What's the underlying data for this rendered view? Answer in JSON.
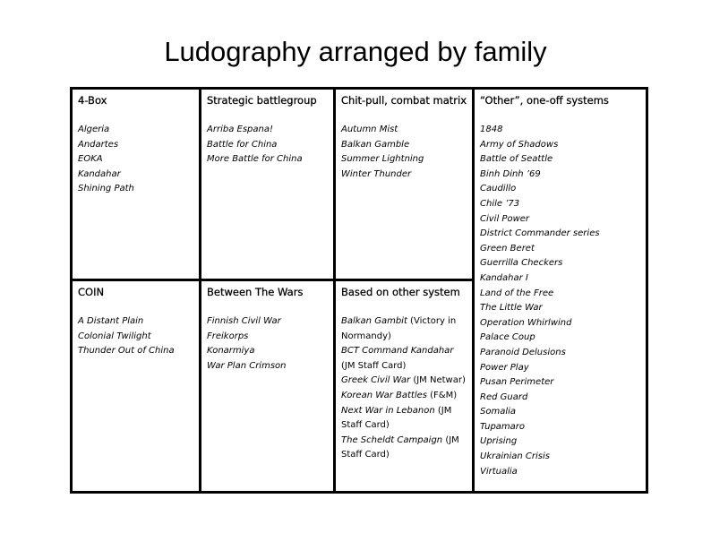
{
  "title": "Ludography arranged by family",
  "families": [
    {
      "heading": "4-Box",
      "games": [
        "Algeria",
        "Andartes",
        "EOKA",
        "Kandahar",
        "Shining Path"
      ]
    },
    {
      "heading": "Strategic battlegroup",
      "games": [
        "Arriba Espana!",
        "Battle for China",
        "More Battle for China"
      ]
    },
    {
      "heading": "Chit-pull, combat matrix",
      "games": [
        "Autumn Mist",
        "Balkan Gamble",
        "Summer Lightning",
        "Winter Thunder"
      ]
    },
    {
      "heading": "“Other”, one-off systems",
      "games": [
        "1848",
        "Army of Shadows",
        "Battle of Seattle",
        "Binh Dinh ’69",
        "Caudillo",
        "Chile ’73",
        "Civil Power",
        "District Commander series",
        "Green Beret",
        "Guerrilla Checkers",
        "Kandahar I",
        "Land of the Free",
        "The Little War",
        "Operation Whirlwind",
        "Palace Coup",
        "Paranoid Delusions",
        "Power Play",
        "Pusan Perimeter",
        "Red Guard",
        "Somalia",
        "Tupamaro",
        "Uprising",
        "Ukrainian Crisis",
        "Virtualia"
      ]
    },
    {
      "heading": "COIN",
      "games": [
        "A Distant Plain",
        "Colonial Twilight",
        "Thunder Out of China"
      ]
    },
    {
      "heading": "Between The Wars",
      "games": [
        "Finnish Civil War",
        "Freikorps",
        "Konarmiya",
        "War Plan Crimson"
      ]
    },
    {
      "heading": "Based on other system",
      "games": [
        {
          "title": "Balkan Gambit",
          "note": " (Victory in Normandy)"
        },
        {
          "title": "BCT Command Kandahar",
          "note": " (JM Staff Card)"
        },
        {
          "title": "Greek Civil War",
          "note": " (JM Netwar)"
        },
        {
          "title": "Korean War Battles",
          "note": " (F&M)"
        },
        {
          "title": "Next War in Lebanon",
          "note": " (JM Staff Card)"
        },
        {
          "title": "The Scheldt Campaign",
          "note": " (JM Staff Card)"
        }
      ]
    }
  ]
}
